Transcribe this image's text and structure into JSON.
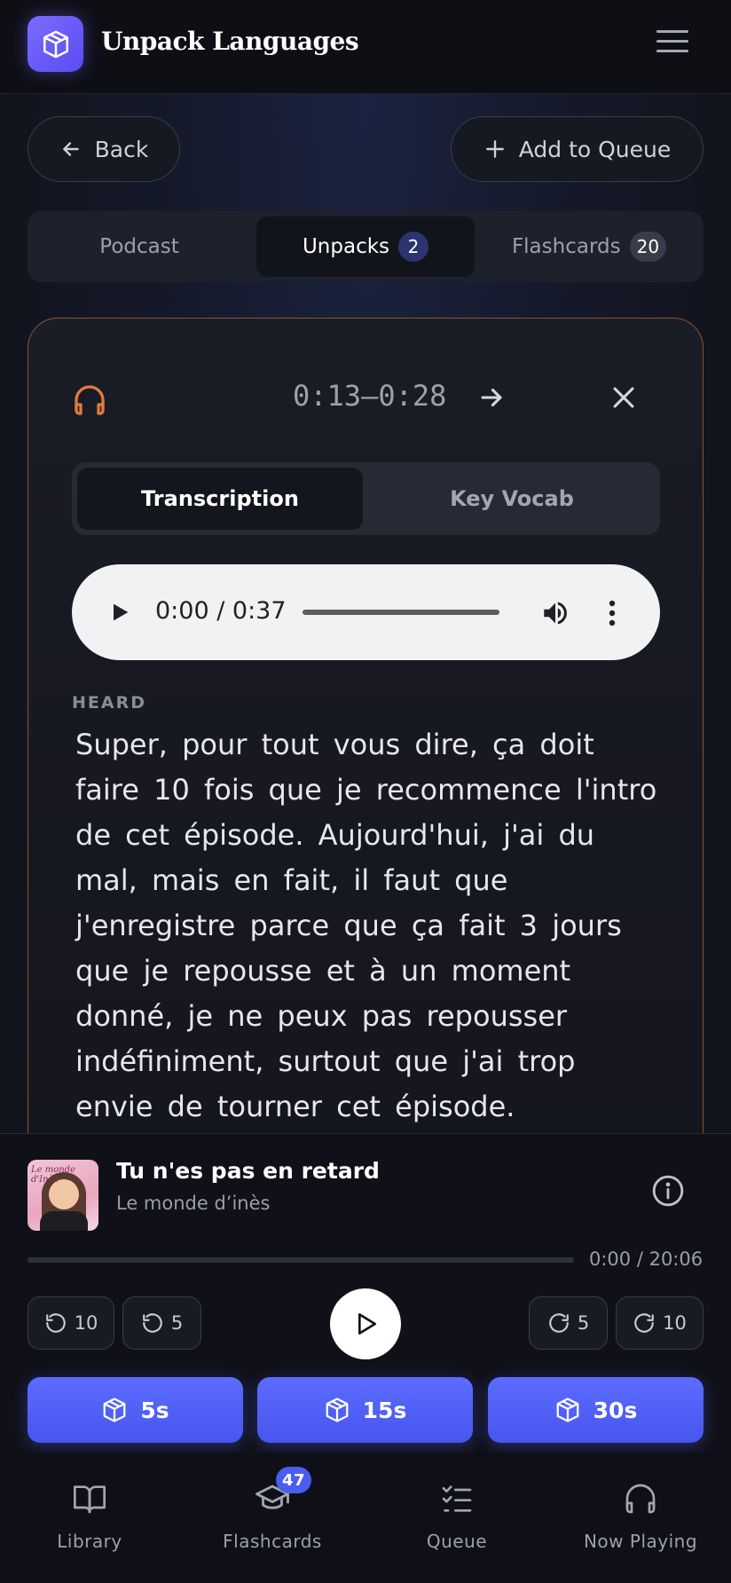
{
  "app": {
    "title": "Unpack Languages",
    "logo_icon": "box-icon",
    "menu_icon": "hamburger-icon"
  },
  "actions": {
    "back_label": "Back",
    "add_queue_label": "Add to Queue"
  },
  "tabs": [
    {
      "label": "Podcast",
      "badge": null
    },
    {
      "label": "Unpacks",
      "badge": "2"
    },
    {
      "label": "Flashcards",
      "badge": "20"
    }
  ],
  "unpack": {
    "time_range": "0:13–0:28",
    "subtabs": [
      "Transcription",
      "Key Vocab"
    ],
    "audio": {
      "time": "0:00 / 0:37"
    },
    "heard_label": "HEARD",
    "heard_text": "Super, pour tout vous dire, ça doit faire 10 fois que je recommence l'intro de cet épisode. Aujourd'hui, j'ai du mal, mais en fait, il faut que j'enregistre parce que ça fait 3 jours que je repousse et à un moment donné, je ne peux pas repousser indéfiniment, surtout que j'ai trop envie de tourner cet épisode.",
    "accent_color": "#e07a3f"
  },
  "player": {
    "cover_text": "Le monde d'Inès",
    "track_title": "Tu n'es pas en retard",
    "artist": "Le monde d’inès",
    "time": "0:00 / 20:06",
    "skip_back": [
      "10",
      "5"
    ],
    "skip_forward": [
      "5",
      "10"
    ],
    "unpack_buttons": [
      "5s",
      "15s",
      "30s"
    ],
    "accent_color": "#4b5cf0"
  },
  "bottom_nav": [
    {
      "label": "Library",
      "icon": "book-icon"
    },
    {
      "label": "Flashcards",
      "icon": "graduation-cap-icon",
      "badge": "47"
    },
    {
      "label": "Queue",
      "icon": "checklist-icon"
    },
    {
      "label": "Now Playing",
      "icon": "headphones-icon"
    }
  ]
}
